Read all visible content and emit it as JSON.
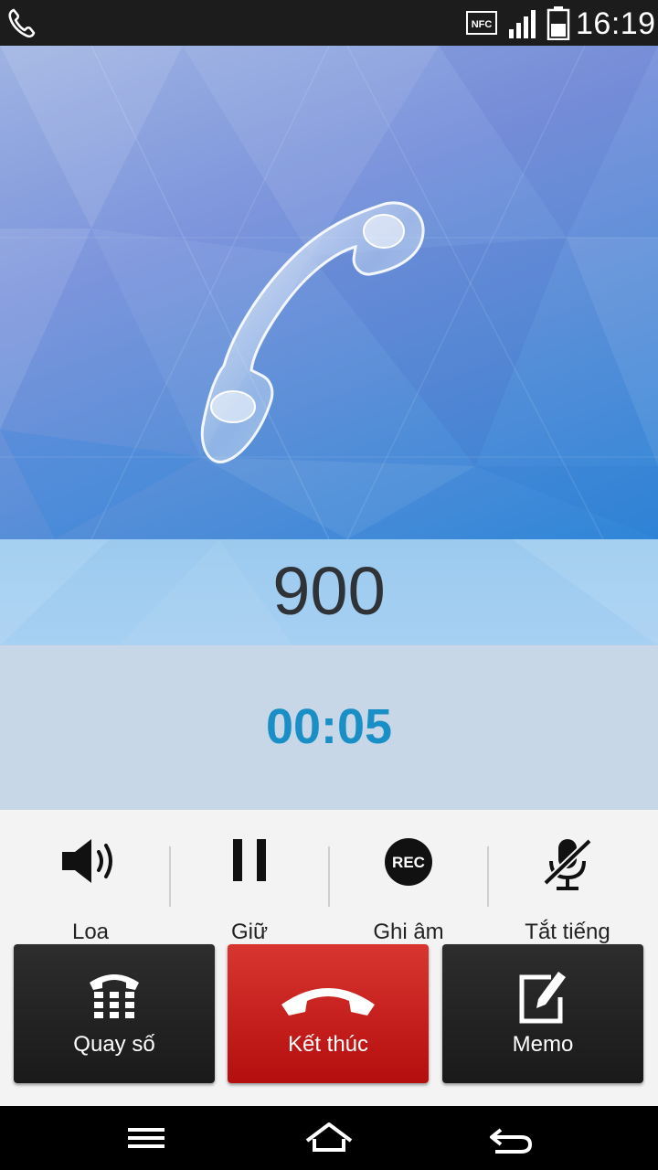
{
  "status_bar": {
    "time": "16:19",
    "icons": [
      "phone-call-icon",
      "nfc-icon",
      "signal-icon",
      "battery-icon"
    ]
  },
  "call": {
    "number": "900",
    "duration": "00:05"
  },
  "toggles": [
    {
      "label": "Loa",
      "icon": "speaker-icon"
    },
    {
      "label": "Giữ",
      "icon": "pause-icon"
    },
    {
      "label": "Ghi âm",
      "icon": "record-icon",
      "icon_text": "REC"
    },
    {
      "label": "Tắt tiếng",
      "icon": "mic-muted-icon"
    }
  ],
  "actions": [
    {
      "label": "Quay số",
      "icon": "dialpad-icon"
    },
    {
      "label": "Kết thúc",
      "icon": "end-call-icon"
    },
    {
      "label": "Memo",
      "icon": "memo-icon"
    }
  ],
  "nav_bar": [
    "menu-icon",
    "home-icon",
    "back-icon"
  ],
  "colors": {
    "timer": "#1a8fc6",
    "end_call": "#c41a17",
    "dark_button": "#222222"
  }
}
